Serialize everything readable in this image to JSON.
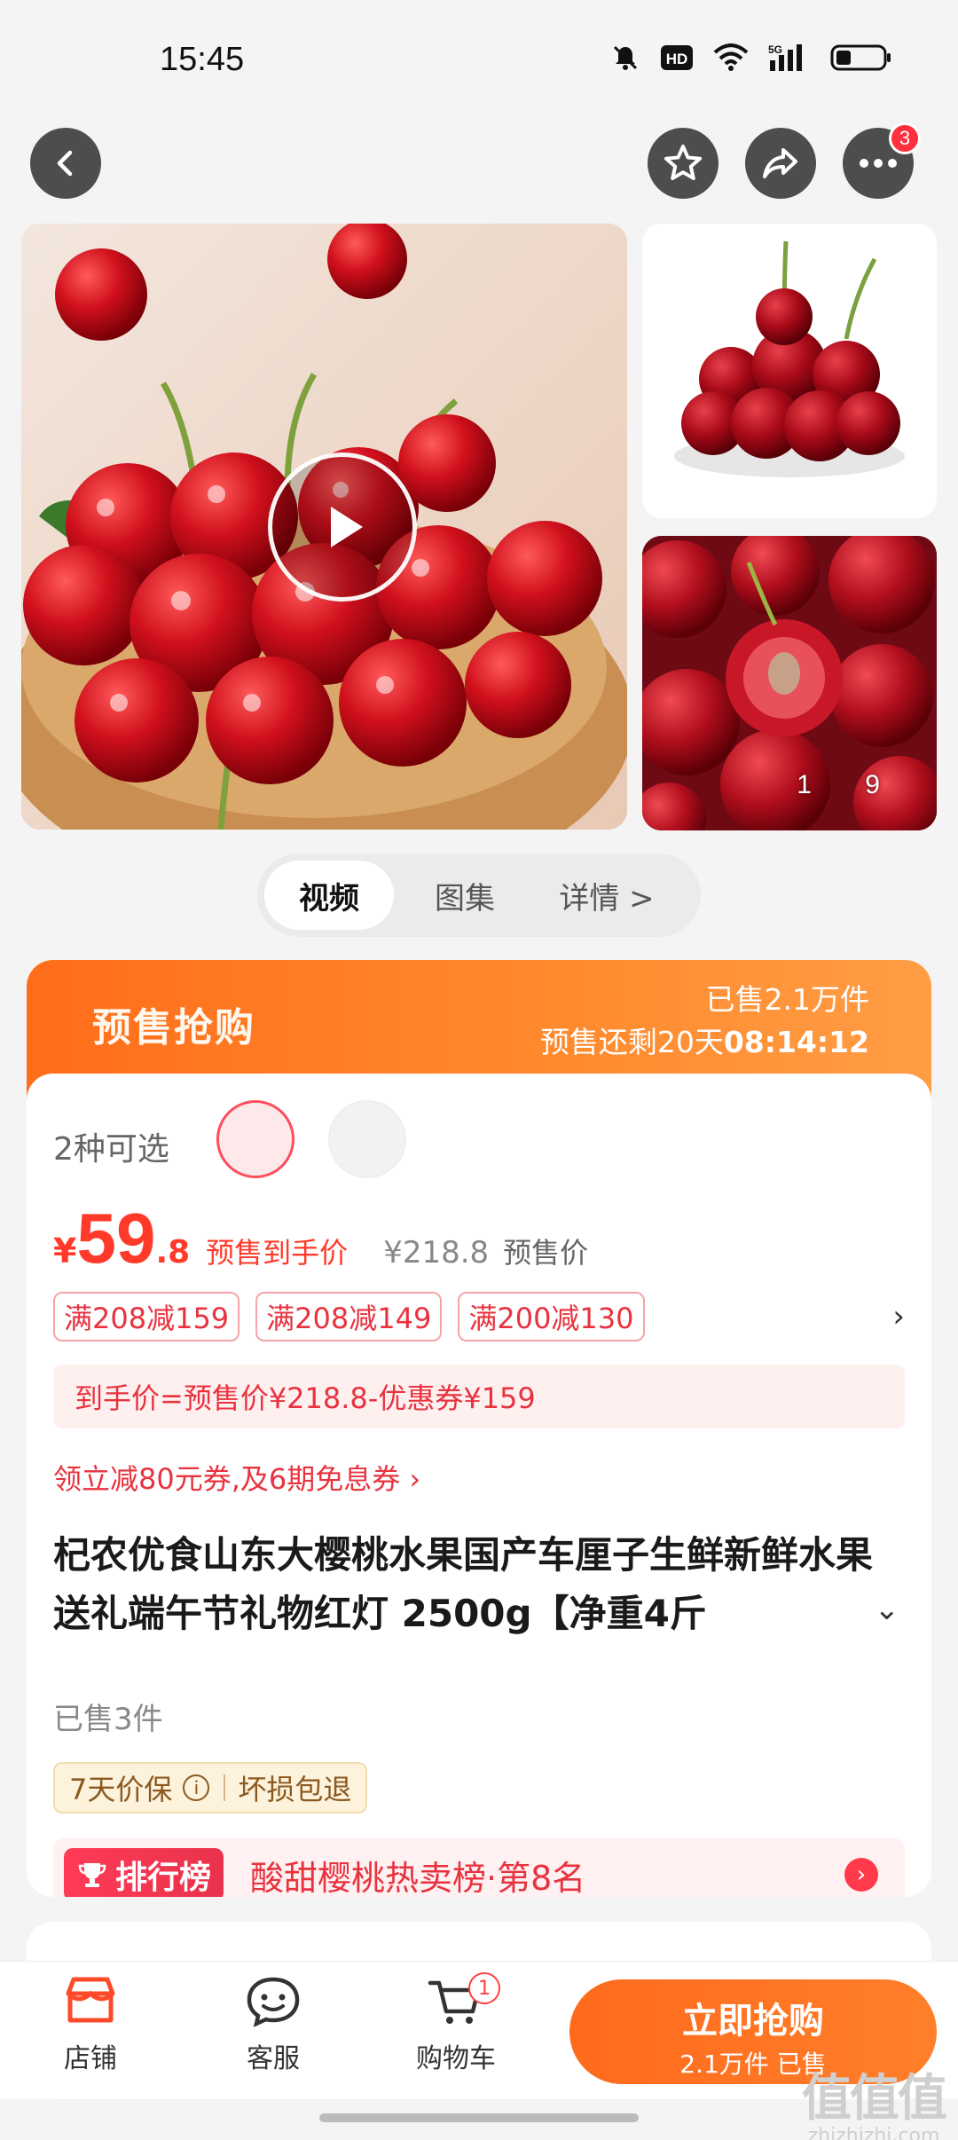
{
  "status_bar": {
    "time": "15:45",
    "icons": [
      "mute-icon",
      "hd-icon",
      "wifi-icon",
      "5g-signal-icon",
      "battery-icon"
    ],
    "hd_label": "HD",
    "network_label": "5G"
  },
  "top_actions": {
    "more_badge": "3"
  },
  "gallery": {
    "thumb_counter": "1 9"
  },
  "media_tabs": {
    "video": "视频",
    "album": "图集",
    "detail": "详情 >"
  },
  "presale": {
    "title": "预售抢购",
    "sold": "已售2.1万件",
    "countdown_prefix": "预售还剩20天",
    "countdown_time": "08:14:12",
    "variant_label": "2种可选",
    "price_currency": "¥",
    "price_int": "59",
    "price_dec": ".8",
    "price_label": "预售到手价",
    "orig_price": "¥218.8",
    "orig_label": "预售价",
    "coupons": [
      "满208减159",
      "满208减149",
      "满200减130"
    ],
    "coupon_more": "›",
    "formula": "到手价=预售价¥218.8-优惠券¥159",
    "promo_link": "领立减80元券,及6期免息券 ›",
    "product_title": "杞农优食山东大樱桃水果国产车厘子生鲜新鲜水果送礼端午节礼物红灯 2500g【净重4斤",
    "title_chevron": "⌄",
    "sold_count": "已售3件",
    "guarantee_1": "7天价保",
    "guarantee_info": "i",
    "guarantee_2": "坏损包退",
    "rank_badge": "排行榜",
    "rank_text": "酸甜樱桃热卖榜·第8名",
    "rank_go": "›"
  },
  "bottom_bar": {
    "shop": "店铺",
    "service": "客服",
    "cart": "购物车",
    "cart_badge": "1",
    "buy_title": "立即抢购",
    "buy_sub": "2.1万件 已售"
  },
  "watermark": {
    "glyph": "值值值",
    "text": "zhizhizhi.com"
  },
  "colors": {
    "accent_red": "#ff3a2a",
    "accent_orange": "#ff6a1c",
    "coupon_red": "#e8333f"
  }
}
